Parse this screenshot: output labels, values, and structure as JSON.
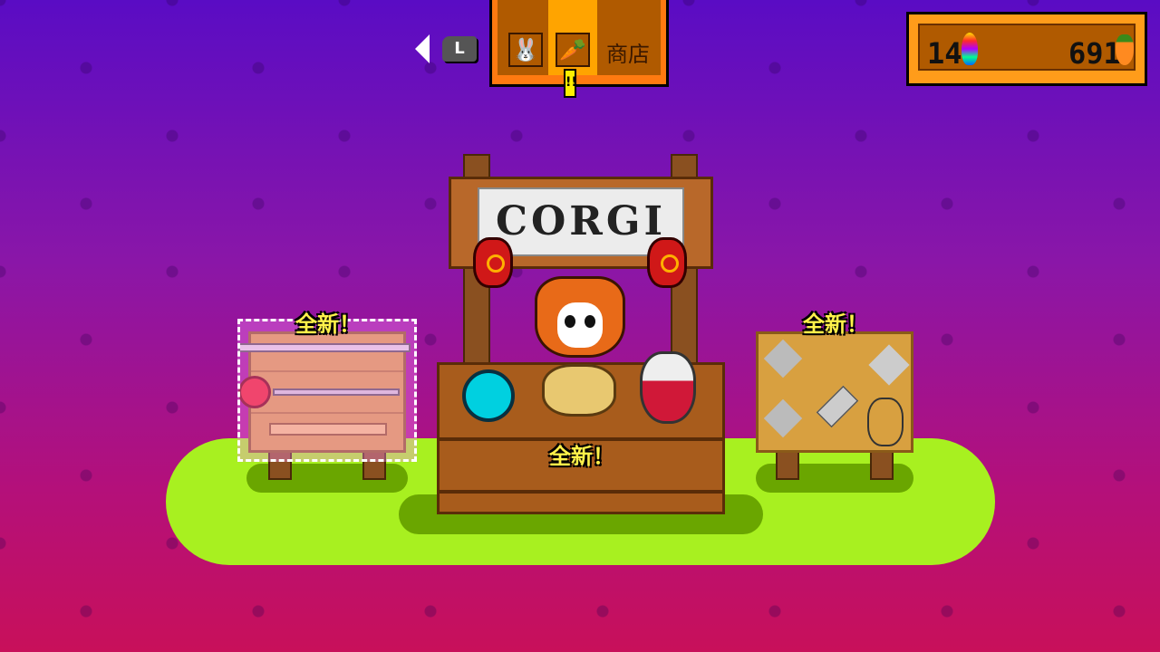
{
  "nav": {
    "prev_button": "L",
    "tabs": [
      {
        "icon": "bunny-icon"
      },
      {
        "icon": "carrot-icon",
        "selected": true
      },
      {
        "label": "商店"
      }
    ],
    "alert": "!!"
  },
  "wallet": {
    "rainbow_count": "14",
    "carrot_count": "691"
  },
  "shop": {
    "sign": "CORGI",
    "new_label_left": "全新！",
    "new_label_center": "全新！",
    "new_label_right": "全新！"
  },
  "colors": {
    "accent": "#ff7a10",
    "new_label": "#fff24a",
    "grass": "#a8f020"
  }
}
